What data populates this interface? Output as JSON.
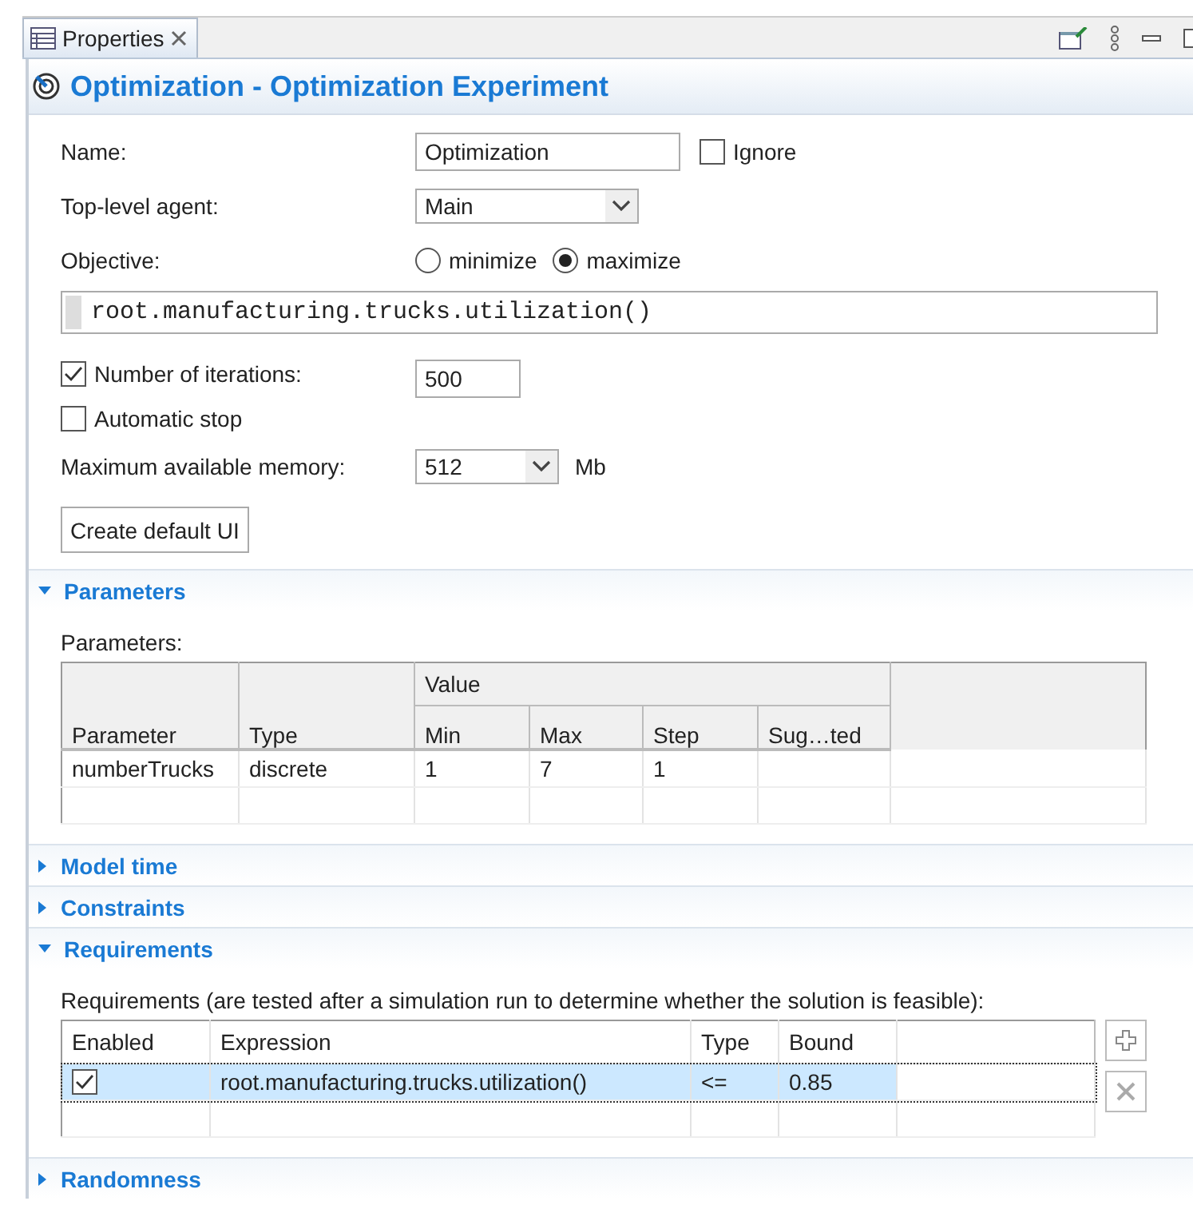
{
  "tab": {
    "label": "Properties",
    "selected": true
  },
  "title": "Optimization - Optimization Experiment",
  "form": {
    "name": {
      "label": "Name:",
      "value": "Optimization"
    },
    "ignore": {
      "label": "Ignore",
      "checked": false
    },
    "top_level_agent": {
      "label": "Top-level agent:",
      "value": "Main"
    },
    "objective": {
      "label": "Objective:",
      "options": [
        {
          "label": "minimize",
          "selected": false
        },
        {
          "label": "maximize",
          "selected": true
        }
      ],
      "expression": "root.manufacturing.trucks.utilization()"
    },
    "iterations": {
      "label": "Number of iterations:",
      "checked": true,
      "value": "500"
    },
    "automatic_stop": {
      "label": "Automatic stop",
      "checked": false
    },
    "memory": {
      "label": "Maximum available memory:",
      "value": "512",
      "unit": "Mb"
    },
    "create_button": "Create default UI"
  },
  "sections": [
    {
      "kind": "parameters",
      "title": "Parameters",
      "expanded": true,
      "caption": "Parameters:",
      "columns": [
        "Parameter",
        "Type"
      ],
      "group": "Value",
      "group_columns": [
        "Min",
        "Max",
        "Step",
        "Sug…ted"
      ],
      "rows": [
        {
          "cells": [
            "numberTrucks",
            "discrete",
            "1",
            "7",
            "1",
            ""
          ]
        }
      ]
    },
    {
      "title": "Model time",
      "expanded": false
    },
    {
      "title": "Constraints",
      "expanded": false
    },
    {
      "kind": "requirements",
      "title": "Requirements",
      "expanded": true,
      "caption": "Requirements (are tested after a simulation run to determine whether the solution is feasible):",
      "columns": [
        "Enabled",
        "Expression",
        "Type",
        "Bound"
      ],
      "rows": [
        {
          "enabled": true,
          "selected": true,
          "expression": "root.manufacturing.trucks.utilization()",
          "type": "<=",
          "bound": "0.85"
        }
      ]
    },
    {
      "title": "Randomness",
      "expanded": false
    }
  ]
}
